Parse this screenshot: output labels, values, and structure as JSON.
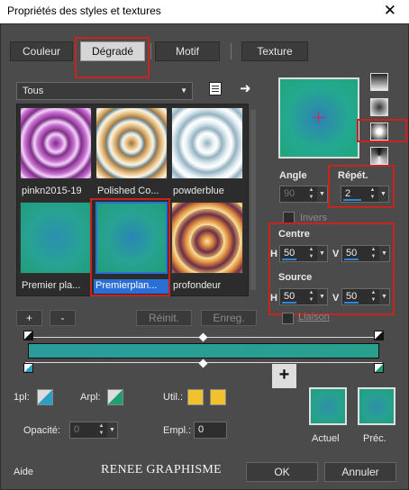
{
  "window": {
    "title": "Propriétés des styles et textures",
    "close_glyph": "✕"
  },
  "tabs": [
    {
      "label": "Couleur",
      "active": false
    },
    {
      "label": "Dégradé",
      "active": true
    },
    {
      "label": "Motif",
      "active": false
    },
    {
      "label": "Texture",
      "active": false
    }
  ],
  "category_select": {
    "value": "Tous"
  },
  "gallery": {
    "items": [
      {
        "label": "pinkn2015-19",
        "selected": false
      },
      {
        "label": "Polished Co...",
        "selected": false
      },
      {
        "label": "powderblue",
        "selected": false
      },
      {
        "label": "Premier pla...",
        "selected": false
      },
      {
        "label": "Premierplan...",
        "selected": true
      },
      {
        "label": "profondeur",
        "selected": false
      }
    ]
  },
  "buttons": {
    "add": "+",
    "remove": "-",
    "reset": "Réinit.",
    "save": "Enreg."
  },
  "angle": {
    "label": "Angle",
    "value": "90"
  },
  "repeat": {
    "label": "Répét.",
    "value": "2"
  },
  "invert": {
    "label": "Invers",
    "checked": false
  },
  "center": {
    "label": "Centre",
    "h_label": "H",
    "h_value": "50",
    "v_label": "V",
    "v_value": "50"
  },
  "source": {
    "label": "Source",
    "h_label": "H",
    "h_value": "50",
    "v_label": "V",
    "v_value": "50"
  },
  "link": {
    "label": "Liaison",
    "checked": false
  },
  "stops_panel": {
    "first_label": "1pl:",
    "background_label": "Arpl:",
    "user_label": "Util.:",
    "opacity_label": "Opacité:",
    "opacity_value": "0",
    "location_label": "Empl.:",
    "location_value": "0"
  },
  "current_label": "Actuel",
  "previous_label": "Préc.",
  "footer": {
    "help": "Aide",
    "brand": "RENEE GRAPHISME",
    "ok": "OK",
    "cancel": "Annuler"
  },
  "colors": {
    "highlight_red": "#c8231e",
    "selection_blue": "#2a6fd6",
    "user_swatch": "#f2c12e",
    "gradient_start": "#2a9c9c",
    "gradient_end": "#27a08e"
  }
}
